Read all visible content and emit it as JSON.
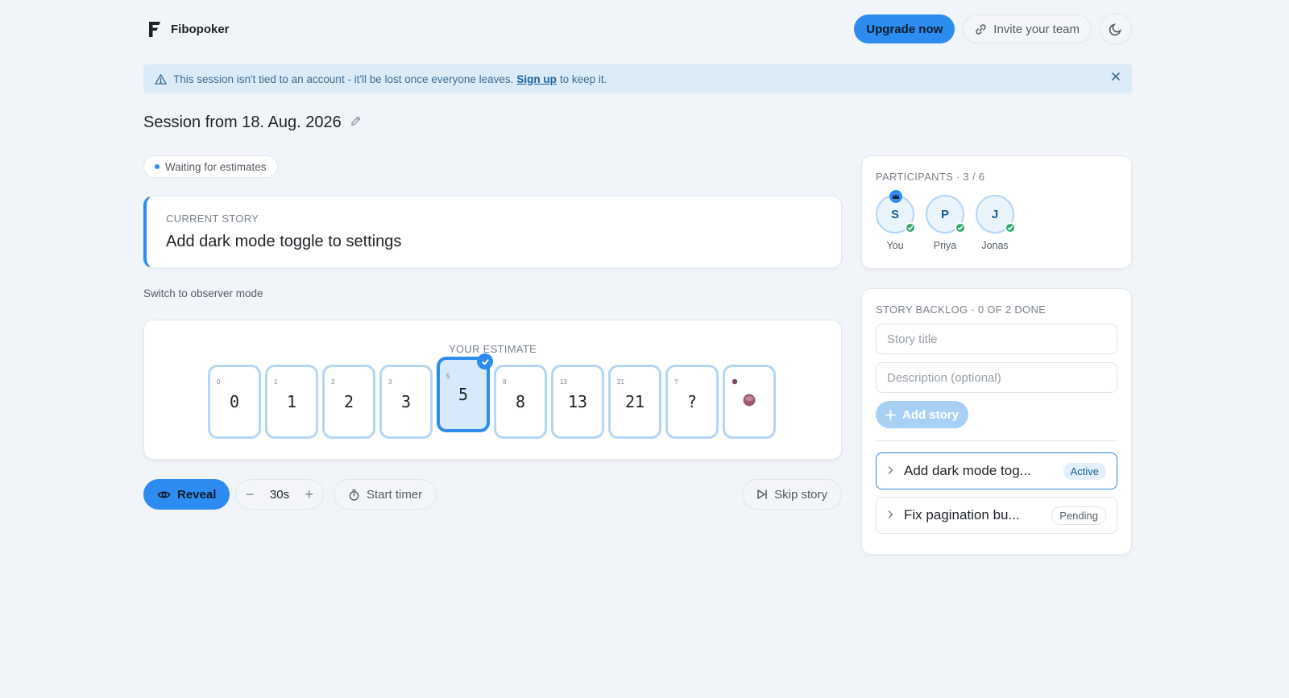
{
  "app": {
    "name": "Fibopoker"
  },
  "header": {
    "upgrade_label": "Upgrade now",
    "invite_label": "Invite your team"
  },
  "banner": {
    "text_before": "This session isn't tied to an account - it'll be lost once everyone leaves.",
    "link_label": "Sign up",
    "text_after": "to keep it."
  },
  "session": {
    "title": "Session from 18. Aug. 2026",
    "status": "Waiting for estimates"
  },
  "current_story": {
    "label": "CURRENT STORY",
    "title": "Add dark mode toggle to settings"
  },
  "observer_label": "Switch to observer mode",
  "deck": {
    "label": "YOUR ESTIMATE",
    "cards": [
      {
        "corner": "0",
        "value": "0",
        "selected": false
      },
      {
        "corner": "1",
        "value": "1",
        "selected": false
      },
      {
        "corner": "2",
        "value": "2",
        "selected": false
      },
      {
        "corner": "3",
        "value": "3",
        "selected": false
      },
      {
        "corner": "5",
        "value": "5",
        "selected": true
      },
      {
        "corner": "8",
        "value": "8",
        "selected": false
      },
      {
        "corner": "13",
        "value": "13",
        "selected": false
      },
      {
        "corner": "21",
        "value": "21",
        "selected": false
      },
      {
        "corner": "?",
        "value": "?",
        "selected": false
      },
      {
        "corner": "coffee-icon",
        "value": "coffee-icon",
        "selected": false
      }
    ]
  },
  "actions": {
    "reveal_label": "Reveal",
    "timer_value": "30s",
    "start_timer_label": "Start timer",
    "skip_label": "Skip story"
  },
  "participants": {
    "heading": "PARTICIPANTS · 3 / 6",
    "list": [
      {
        "initial": "S",
        "name": "You",
        "host": true,
        "voted": true
      },
      {
        "initial": "P",
        "name": "Priya",
        "host": false,
        "voted": true
      },
      {
        "initial": "J",
        "name": "Jonas",
        "host": false,
        "voted": true
      }
    ]
  },
  "backlog": {
    "heading": "STORY BACKLOG · 0 OF 2 DONE",
    "title_placeholder": "Story title",
    "description_placeholder": "Description (optional)",
    "add_label": "Add story",
    "items": [
      {
        "title": "Add dark mode tog...",
        "status": "Active"
      },
      {
        "title": "Fix pagination bu...",
        "status": "Pending"
      }
    ]
  },
  "colors": {
    "accent": "#2d8cf0",
    "background": "#f1f4f8",
    "banner": "#dcebf8",
    "success": "#2fa86e"
  }
}
